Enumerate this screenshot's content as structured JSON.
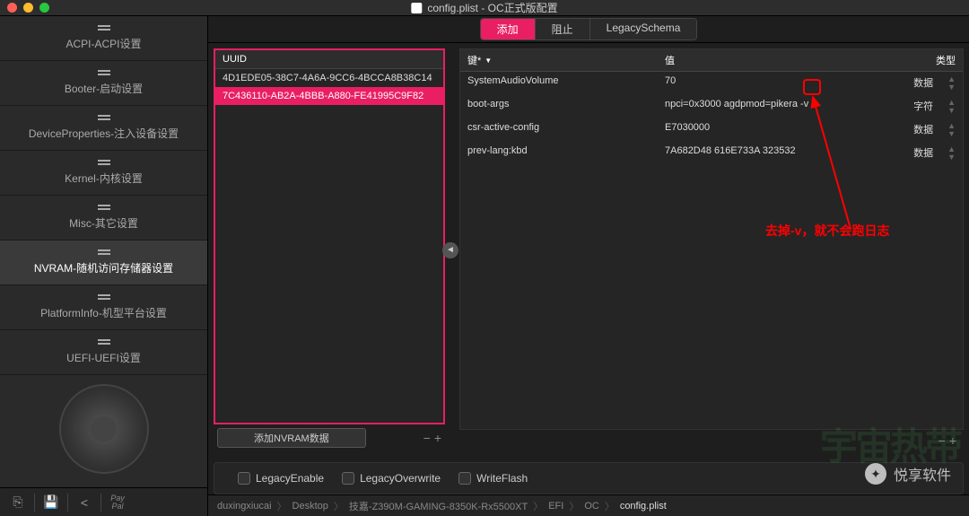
{
  "window": {
    "title": "config.plist - OC正式版配置"
  },
  "sidebar": {
    "items": [
      {
        "label": "ACPI-ACPI设置"
      },
      {
        "label": "Booter-启动设置"
      },
      {
        "label": "DeviceProperties-注入设备设置"
      },
      {
        "label": "Kernel-内核设置"
      },
      {
        "label": "Misc-其它设置"
      },
      {
        "label": "NVRAM-随机访问存储器设置"
      },
      {
        "label": "PlatformInfo-机型平台设置"
      },
      {
        "label": "UEFI-UEFI设置"
      }
    ]
  },
  "tabs": {
    "items": [
      {
        "label": "添加"
      },
      {
        "label": "阻止"
      },
      {
        "label": "LegacySchema"
      }
    ]
  },
  "uuid_panel": {
    "header": "UUID",
    "rows": [
      "4D1EDE05-38C7-4A6A-9CC6-4BCCA8B38C14",
      "7C436110-AB2A-4BBB-A880-FE41995C9F82"
    ],
    "add_button": "添加NVRAM数据"
  },
  "data_table": {
    "headers": {
      "key": "键*",
      "value": "值",
      "type": "类型"
    },
    "rows": [
      {
        "key": "SystemAudioVolume",
        "value": "70",
        "type": "数据"
      },
      {
        "key": "boot-args",
        "value": "npci=0x3000 agdpmod=pikera -v",
        "type": "字符"
      },
      {
        "key": "csr-active-config",
        "value": "E7030000",
        "type": "数据"
      },
      {
        "key": "prev-lang:kbd",
        "value": "7A682D48 616E733A 323532",
        "type": "数据"
      }
    ]
  },
  "annotation": "去掉-v，就不会跑日志",
  "checkboxes": [
    {
      "label": "LegacyEnable"
    },
    {
      "label": "LegacyOverwrite"
    },
    {
      "label": "WriteFlash"
    }
  ],
  "breadcrumb": [
    "duxingxiucai",
    "Desktop",
    "技嘉-Z390M-GAMING-8350K-Rx5500XT",
    "EFI",
    "OC",
    "config.plist"
  ],
  "ghost_text": "宇宙热带",
  "watermark": "悦享软件"
}
